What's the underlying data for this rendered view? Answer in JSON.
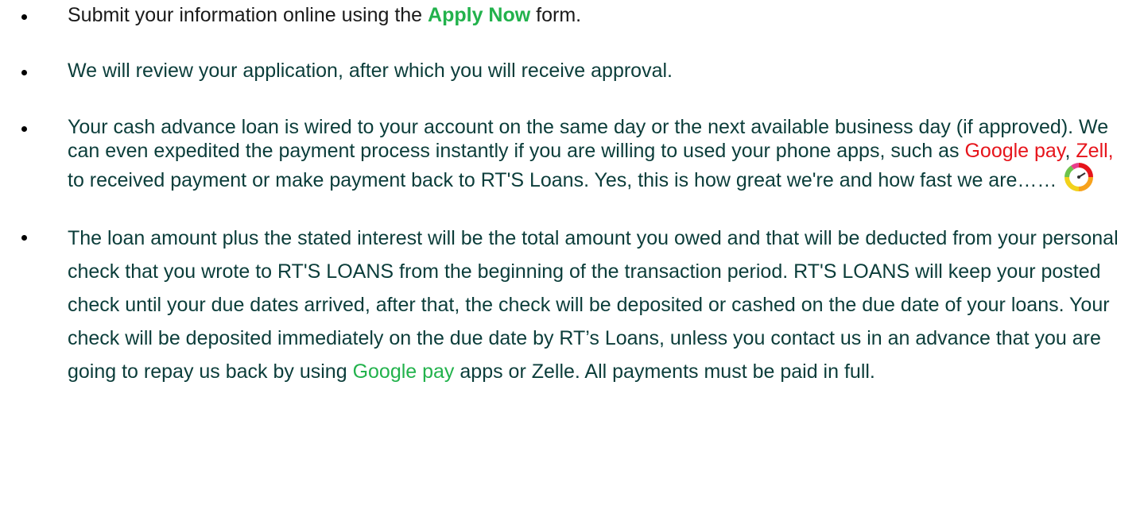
{
  "steps": [
    {
      "pre": "Submit your information online using the ",
      "link": "Apply Now",
      "post": " form."
    },
    {
      "text": "We will review your application, after which you will receive approval."
    },
    {
      "part1": "Your cash advance loan is wired to your account on the same day or the next available business day (if approved). We can even expedited the payment process instantly  if you are willing to used your phone apps, such as ",
      "app1": "Google pay",
      "sep": ", ",
      "app2": "Zell,",
      "part2": " to received payment or make payment back to RT'S Loans. Yes, this is how great we're and how fast we are……",
      "icon": "speedometer-gauge-icon"
    },
    {
      "part1": "The loan amount plus the stated interest will be the total amount you owed and that will be deducted from your personal check that you wrote to RT'S LOANS from the beginning of the transaction period. RT'S LOANS will keep your posted check until your due dates arrived, after that, the check will be deposited or cashed on the due date of your loans. Your check will be deposited immediately on the due date by RT’s Loans, unless you contact us in an advance that you are going to repay us back by using ",
      "app": "Google pay",
      "part2": " apps or Zelle. All payments must be paid in full."
    }
  ],
  "colors": {
    "apply_now": "#22b24c",
    "google_pay_red": "#e6141b",
    "zell_red": "#e6141b",
    "google_pay_green": "#22b24c",
    "teal_text": "#0b3d3a"
  }
}
